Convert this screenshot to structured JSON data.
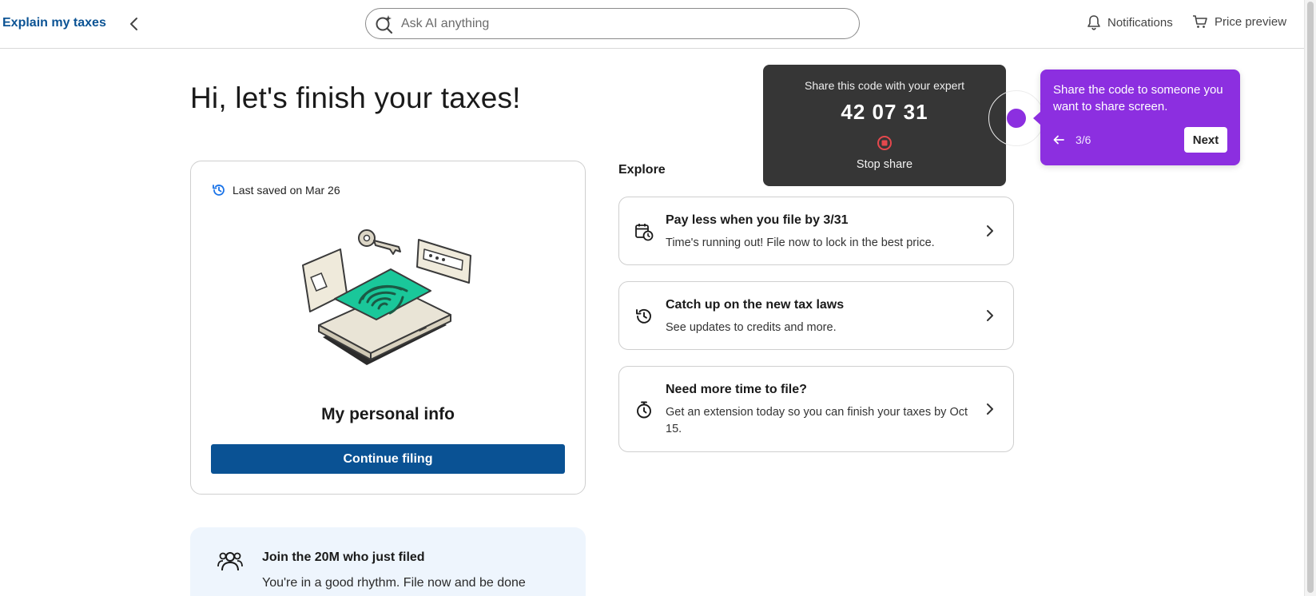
{
  "topbar": {
    "explain_link": "Explain my taxes",
    "search_placeholder": "Ask AI anything",
    "notifications_label": "Notifications",
    "price_preview_label": "Price preview"
  },
  "greeting": "Hi, let's finish your taxes!",
  "personal_card": {
    "last_saved": "Last saved on Mar 26",
    "title": "My personal info",
    "continue_label": "Continue filing"
  },
  "join_banner": {
    "title": "Join the 20M who just filed",
    "text": "You're in a good rhythm. File now and be done"
  },
  "explore": {
    "heading": "Explore",
    "items": [
      {
        "icon": "calendar-clock-icon",
        "title": "Pay less when you file by 3/31",
        "subtitle": "Time's running out! File now to lock in the best price."
      },
      {
        "icon": "history-icon",
        "title": "Catch up on the new tax laws",
        "subtitle": "See updates to credits and more."
      },
      {
        "icon": "stopwatch-icon",
        "title": "Need more time to file?",
        "subtitle": "Get an extension today so you can finish your taxes by Oct 15."
      }
    ]
  },
  "share_overlay": {
    "label": "Share this code with your expert",
    "code": "42 07 31",
    "stop_label": "Stop share",
    "stop_color": "#e5484d"
  },
  "coach_tip": {
    "text": "Share the code to someone you want to share screen.",
    "step": "3/6",
    "next_label": "Next",
    "accent_color": "#8c2fe0"
  },
  "colors": {
    "brand_blue": "#0a5294",
    "link_blue": "#0b5394",
    "teal_accent": "#1ac79a"
  }
}
